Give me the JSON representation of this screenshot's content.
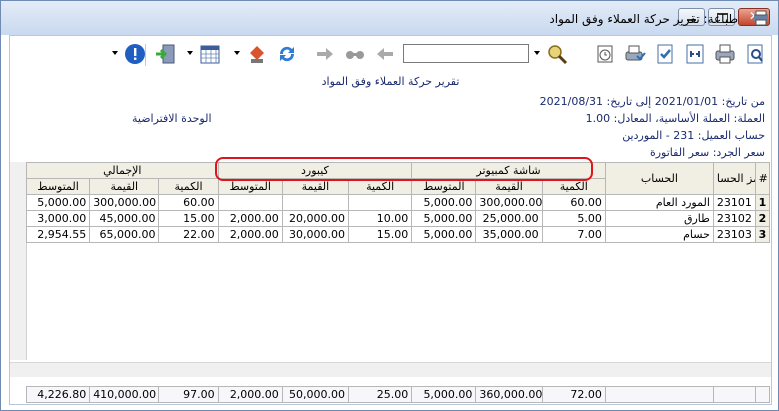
{
  "window": {
    "title": "طباعة: تقرير حركة العملاء وفق المواد",
    "close_glyph": "✕"
  },
  "toolbar": {
    "search_value": "",
    "icons": [
      "preview-icon",
      "print-icon",
      "print-setup-icon",
      "export-icon",
      "checklist-icon",
      "printer-list-icon",
      "zoom-icon",
      "first-page-icon",
      "find-icon",
      "next-icon",
      "refresh-icon",
      "fill-icon",
      "calendar-icon",
      "exit-icon",
      "help-icon"
    ]
  },
  "report": {
    "title": "تقرير حركة العملاء وفق المواد",
    "date_range": "من تاريخ: 2021/01/01 إلى تاريخ: 2021/08/31",
    "currency": "العملة: العملة الأساسية، المعادل: 1.00",
    "unit": "الوحدة الافتراضية",
    "account": "حساب العميل: 231 - الموردين",
    "price": "سعر الجرد: سعر الفاتورة"
  },
  "grid": {
    "hash": "#",
    "code_header": "رمز الحسا",
    "account_header": "الحساب",
    "groups": [
      "شاشة كمبيوتر",
      "كيبورد",
      "الإجمالي"
    ],
    "sub_headers": [
      "الكمية",
      "القيمة",
      "المتوسط"
    ],
    "rows": [
      {
        "idx": "1",
        "code": "23101",
        "account": "المورد العام",
        "g1": [
          "60.00",
          "300,000.00",
          "5,000.00"
        ],
        "g2": [
          "",
          "",
          ""
        ],
        "g3": [
          "60.00",
          "300,000.00",
          "5,000.00"
        ]
      },
      {
        "idx": "2",
        "code": "23102",
        "account": "طارق",
        "g1": [
          "5.00",
          "25,000.00",
          "5,000.00"
        ],
        "g2": [
          "10.00",
          "20,000.00",
          "2,000.00"
        ],
        "g3": [
          "15.00",
          "45,000.00",
          "3,000.00"
        ]
      },
      {
        "idx": "3",
        "code": "23103",
        "account": "حسام",
        "g1": [
          "7.00",
          "35,000.00",
          "5,000.00"
        ],
        "g2": [
          "15.00",
          "30,000.00",
          "2,000.00"
        ],
        "g3": [
          "22.00",
          "65,000.00",
          "2,954.55"
        ]
      }
    ],
    "totals": {
      "g1": [
        "72.00",
        "360,000.00",
        "5,000.00"
      ],
      "g2": [
        "25.00",
        "50,000.00",
        "2,000.00"
      ],
      "g3": [
        "97.00",
        "410,000.00",
        "4,226.80"
      ]
    }
  }
}
